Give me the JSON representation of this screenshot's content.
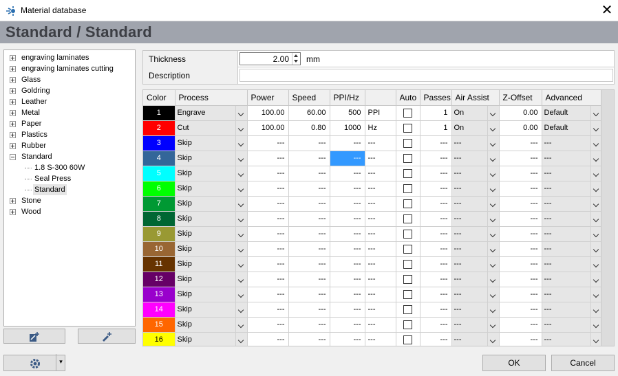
{
  "window": {
    "title": "Material database",
    "close_glyph": "✕",
    "app_icon": "laser-logo-icon"
  },
  "header": {
    "title": "Standard / Standard"
  },
  "tree": {
    "before": [
      {
        "label": "engraving laminates",
        "expanded": false
      },
      {
        "label": "engraving laminates cutting",
        "expanded": false
      },
      {
        "label": "Glass",
        "expanded": false
      },
      {
        "label": "Goldring",
        "expanded": false
      },
      {
        "label": "Leather",
        "expanded": false
      },
      {
        "label": "Metal",
        "expanded": false
      },
      {
        "label": "Paper",
        "expanded": false
      },
      {
        "label": "Plastics",
        "expanded": false
      },
      {
        "label": "Rubber",
        "expanded": false
      }
    ],
    "open": {
      "label": "Standard",
      "expanded": true,
      "children": [
        "1.8 S-300 60W",
        "Seal Press",
        "Standard"
      ],
      "selected_child": "Standard"
    },
    "after": [
      {
        "label": "Stone",
        "expanded": false
      },
      {
        "label": "Wood",
        "expanded": false
      }
    ]
  },
  "tree_buttons": {
    "add_material_icon": "add-material-icon",
    "add_setting_icon": "add-setting-icon"
  },
  "properties": {
    "thickness_label": "Thickness",
    "thickness_value": "2.00",
    "thickness_unit": "mm",
    "description_label": "Description",
    "description_value": ""
  },
  "grid": {
    "headers": [
      "Color",
      "Process",
      "Power",
      "Speed",
      "PPI/Hz",
      "",
      "Auto",
      "Passes",
      "Air Assist",
      "Z-Offset",
      "Advanced"
    ],
    "rows": [
      {
        "color_num": "1",
        "color_hex": "#000000",
        "text_color": "#ffffff",
        "process": "Engrave",
        "power": "100.00",
        "speed": "60.00",
        "ppi": "500",
        "unit": "PPI",
        "passes": "1",
        "air": "On",
        "z": "0.00",
        "advanced": "Default"
      },
      {
        "color_num": "2",
        "color_hex": "#ff0000",
        "text_color": "#ffffff",
        "process": "Cut",
        "power": "100.00",
        "speed": "0.80",
        "ppi": "1000",
        "unit": "Hz",
        "passes": "1",
        "air": "On",
        "z": "0.00",
        "advanced": "Default"
      },
      {
        "color_num": "3",
        "color_hex": "#0000ff",
        "text_color": "#ffffff",
        "process": "Skip",
        "power": "---",
        "speed": "---",
        "ppi": "---",
        "unit": "---",
        "passes": "---",
        "air": "---",
        "z": "---",
        "advanced": "---"
      },
      {
        "color_num": "4",
        "color_hex": "#336699",
        "text_color": "#ffffff",
        "process": "Skip",
        "power": "---",
        "speed": "---",
        "ppi": "---",
        "unit": "---",
        "passes": "---",
        "air": "---",
        "z": "---",
        "advanced": "---",
        "highlight_ppi": true
      },
      {
        "color_num": "5",
        "color_hex": "#00ffff",
        "text_color": "#ffffff",
        "process": "Skip",
        "power": "---",
        "speed": "---",
        "ppi": "---",
        "unit": "---",
        "passes": "---",
        "air": "---",
        "z": "---",
        "advanced": "---"
      },
      {
        "color_num": "6",
        "color_hex": "#00ff00",
        "text_color": "#ffffff",
        "process": "Skip",
        "power": "---",
        "speed": "---",
        "ppi": "---",
        "unit": "---",
        "passes": "---",
        "air": "---",
        "z": "---",
        "advanced": "---"
      },
      {
        "color_num": "7",
        "color_hex": "#009933",
        "text_color": "#ffffff",
        "process": "Skip",
        "power": "---",
        "speed": "---",
        "ppi": "---",
        "unit": "---",
        "passes": "---",
        "air": "---",
        "z": "---",
        "advanced": "---"
      },
      {
        "color_num": "8",
        "color_hex": "#006633",
        "text_color": "#ffffff",
        "process": "Skip",
        "power": "---",
        "speed": "---",
        "ppi": "---",
        "unit": "---",
        "passes": "---",
        "air": "---",
        "z": "---",
        "advanced": "---"
      },
      {
        "color_num": "9",
        "color_hex": "#999933",
        "text_color": "#ffffff",
        "process": "Skip",
        "power": "---",
        "speed": "---",
        "ppi": "---",
        "unit": "---",
        "passes": "---",
        "air": "---",
        "z": "---",
        "advanced": "---"
      },
      {
        "color_num": "10",
        "color_hex": "#996633",
        "text_color": "#ffffff",
        "process": "Skip",
        "power": "---",
        "speed": "---",
        "ppi": "---",
        "unit": "---",
        "passes": "---",
        "air": "---",
        "z": "---",
        "advanced": "---"
      },
      {
        "color_num": "11",
        "color_hex": "#663300",
        "text_color": "#ffffff",
        "process": "Skip",
        "power": "---",
        "speed": "---",
        "ppi": "---",
        "unit": "---",
        "passes": "---",
        "air": "---",
        "z": "---",
        "advanced": "---"
      },
      {
        "color_num": "12",
        "color_hex": "#660066",
        "text_color": "#ffffff",
        "process": "Skip",
        "power": "---",
        "speed": "---",
        "ppi": "---",
        "unit": "---",
        "passes": "---",
        "air": "---",
        "z": "---",
        "advanced": "---"
      },
      {
        "color_num": "13",
        "color_hex": "#9900cc",
        "text_color": "#ffffff",
        "process": "Skip",
        "power": "---",
        "speed": "---",
        "ppi": "---",
        "unit": "---",
        "passes": "---",
        "air": "---",
        "z": "---",
        "advanced": "---"
      },
      {
        "color_num": "14",
        "color_hex": "#ff00ff",
        "text_color": "#ffffff",
        "process": "Skip",
        "power": "---",
        "speed": "---",
        "ppi": "---",
        "unit": "---",
        "passes": "---",
        "air": "---",
        "z": "---",
        "advanced": "---"
      },
      {
        "color_num": "15",
        "color_hex": "#ff6600",
        "text_color": "#ffffff",
        "process": "Skip",
        "power": "---",
        "speed": "---",
        "ppi": "---",
        "unit": "---",
        "passes": "---",
        "air": "---",
        "z": "---",
        "advanced": "---"
      },
      {
        "color_num": "16",
        "color_hex": "#ffff00",
        "text_color": "#000000",
        "process": "Skip",
        "power": "---",
        "speed": "---",
        "ppi": "---",
        "unit": "---",
        "passes": "---",
        "air": "---",
        "z": "---",
        "advanced": "---"
      }
    ]
  },
  "footer": {
    "settings_icon": "gear-icon",
    "ok_label": "OK",
    "cancel_label": "Cancel"
  }
}
